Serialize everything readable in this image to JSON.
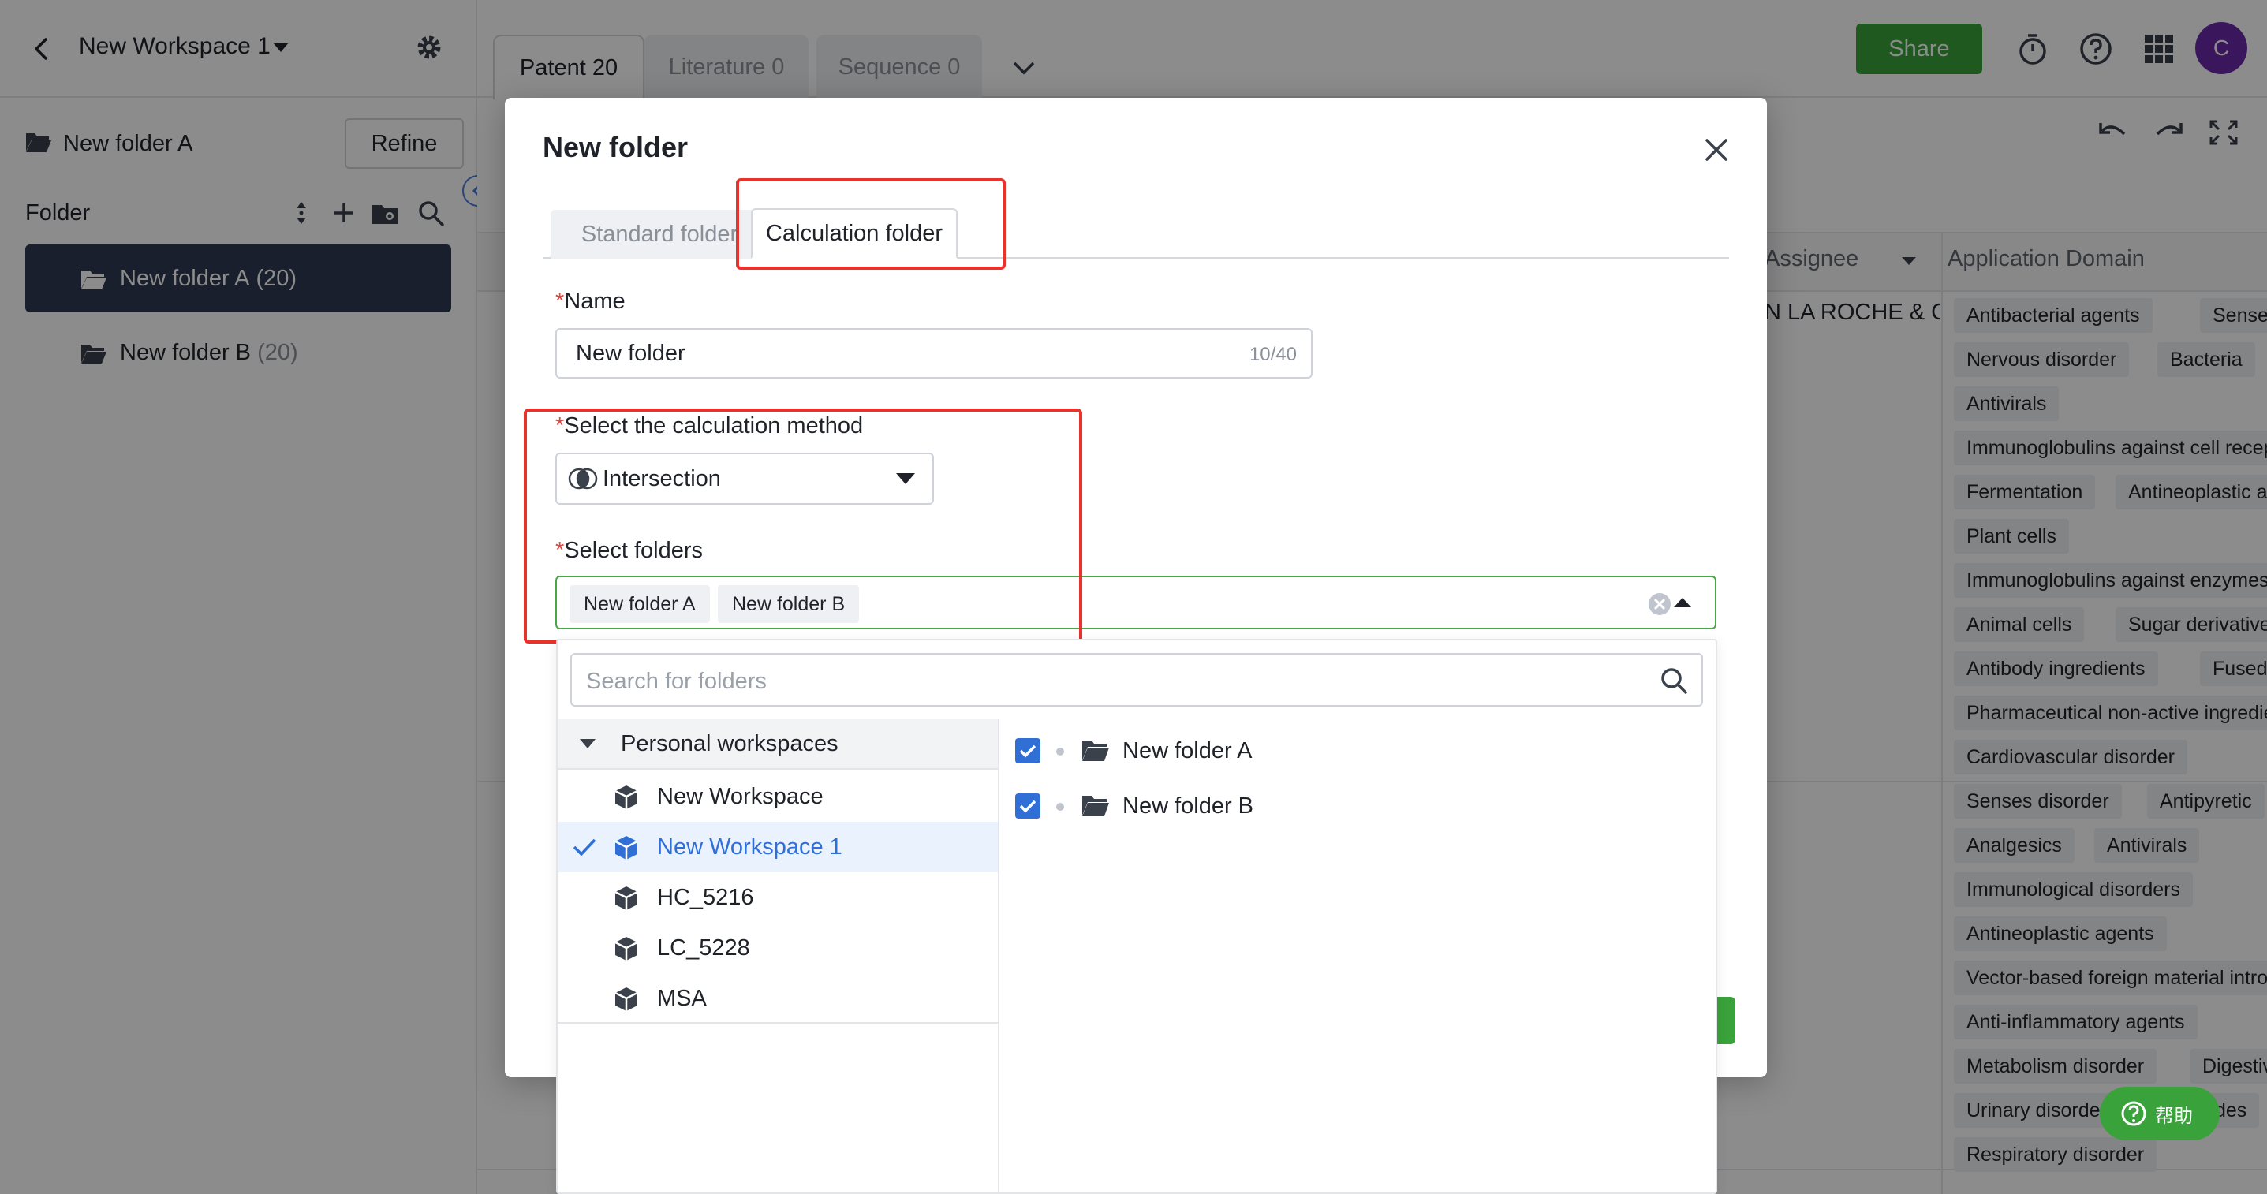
{
  "app": {
    "workspace_title": "New Workspace 1",
    "current_folder": "New folder A",
    "refine_label": "Refine",
    "folder_section_label": "Folder",
    "folders": [
      {
        "name": "New folder A",
        "count": "(20)"
      },
      {
        "name": "New folder B",
        "count": "(20)"
      }
    ]
  },
  "topbar": {
    "tabs": [
      {
        "label": "Patent 20"
      },
      {
        "label": "Literature 0"
      },
      {
        "label": "Sequence 0"
      }
    ],
    "share_label": "Share",
    "avatar_letter": "C"
  },
  "grid": {
    "col_assignee": "Assignee",
    "col_application_domain": "Application Domain",
    "assignee_value": "N LA ROCHE & C",
    "tags": [
      [
        "Antibacterial agents",
        "Senses disorder"
      ],
      [
        "Nervous disorder",
        "Bacteria"
      ],
      [
        "Antivirals"
      ],
      [
        "Immunoglobulins against cell receptors"
      ],
      [
        "Fermentation",
        "Antineoplastic agents"
      ],
      [
        "Plant cells"
      ],
      [
        "Immunoglobulins against enzymes"
      ],
      [
        "Animal cells",
        "Sugar derivatives"
      ],
      [
        "Antibody ingredients",
        "Fused cells"
      ],
      [
        "Pharmaceutical non-active ingredients"
      ],
      [
        "Cardiovascular disorder"
      ],
      [
        "Senses disorder",
        "Antipyretic"
      ],
      [
        "Analgesics",
        "Antivirals"
      ],
      [
        "Immunological disorders"
      ],
      [
        "Antineoplastic agents"
      ],
      [
        "Vector-based foreign material introduction"
      ],
      [
        "Anti-inflammatory agents"
      ],
      [
        "Metabolism disorder",
        "Digestive system disorder"
      ],
      [
        "Urinary disorder",
        "Peptides"
      ],
      [
        "Respiratory disorder"
      ]
    ]
  },
  "help_label": "帮助",
  "modal": {
    "title": "New folder",
    "tabs": {
      "standard": "Standard folder",
      "calculation": "Calculation folder"
    },
    "name_label": "Name",
    "name_value": "New folder",
    "name_count": "10/40",
    "method_label": "Select the calculation method",
    "method_value": "Intersection",
    "folders_label": "Select folders",
    "selected_folders": [
      "New folder A",
      "New folder B"
    ],
    "required_mark": "*"
  },
  "dropdown": {
    "search_placeholder": "Search for folders",
    "group_label": "Personal workspaces",
    "workspaces": [
      "New Workspace",
      "New Workspace 1",
      "HC_5216",
      "LC_5228",
      "MSA"
    ],
    "selected_workspace": "New Workspace 1",
    "folders": [
      "New folder A",
      "New folder B"
    ]
  },
  "colors": {
    "accent_green": "#3aa23a",
    "highlight_red": "#e8322b",
    "selected_blue": "#2f6fd6",
    "sidebar_active": "#2e3a52"
  }
}
